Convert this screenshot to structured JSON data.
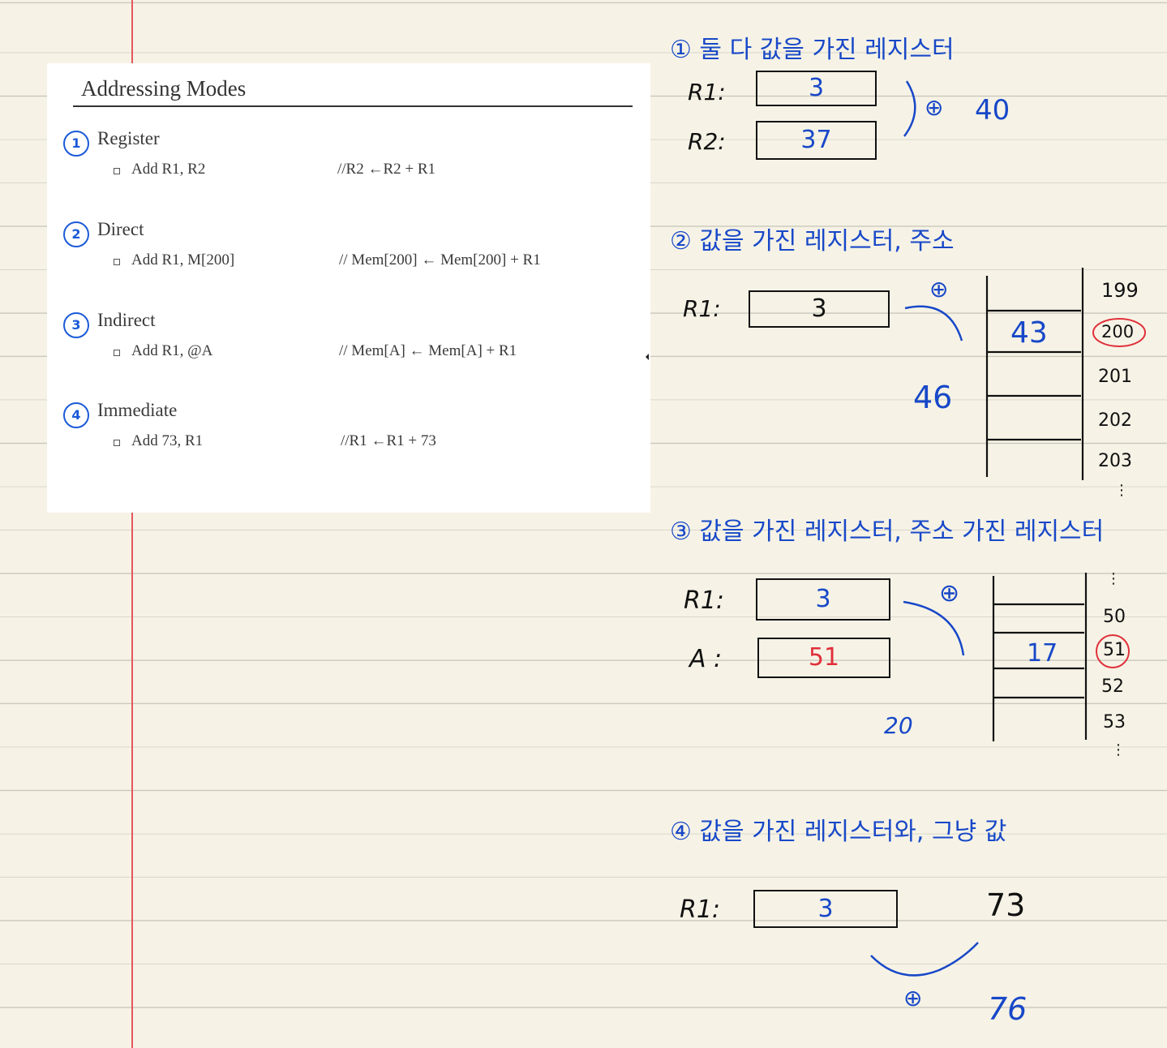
{
  "slide": {
    "title": "Addressing Modes",
    "modes": [
      {
        "number": "1",
        "name": "Register",
        "code": "Add R1, R2",
        "comment": "//R2 ←R2 + R1"
      },
      {
        "number": "2",
        "name": "Direct",
        "code": "Add R1, M[200]",
        "comment": "// Mem[200] ← Mem[200] + R1"
      },
      {
        "number": "3",
        "name": "Indirect",
        "code": "Add R1, @A",
        "comment": "//  Mem[A] ← Mem[A] + R1"
      },
      {
        "number": "4",
        "name": "Immediate",
        "code": "Add 73, R1",
        "comment": "//R1 ←R1 + 73"
      }
    ]
  },
  "notes": {
    "s1": {
      "heading": "① 둘 다 값을 가진 레지스터",
      "reg1_label": "R1:",
      "reg1_value": "3",
      "reg2_label": "R2:",
      "reg2_value": "37",
      "op": "⊕",
      "result": "40"
    },
    "s2": {
      "heading": "② 값을 가진 레지스터, 주소",
      "reg_label": "R1:",
      "reg_value": "3",
      "op": "⊕",
      "result": "46",
      "mem_value": "43",
      "addresses": [
        "199",
        "200",
        "201",
        "202",
        "203"
      ],
      "more": "⋮"
    },
    "s3": {
      "heading": "③ 값을 가진 레지스터, 주소 가진 레지스터",
      "reg_label": "R1:",
      "reg_value": "3",
      "a_label": "A :",
      "a_value": "51",
      "op": "⊕",
      "result": "20",
      "mem_value": "17",
      "addresses": [
        "50",
        "51",
        "52",
        "53"
      ],
      "more_top": "⋮",
      "more_bottom": "⋮"
    },
    "s4": {
      "heading": "④ 값을 가진 레지스터와, 그냥 값",
      "reg_label": "R1:",
      "reg_value": "3",
      "immediate": "73",
      "op": "⊕",
      "result": "76"
    }
  }
}
